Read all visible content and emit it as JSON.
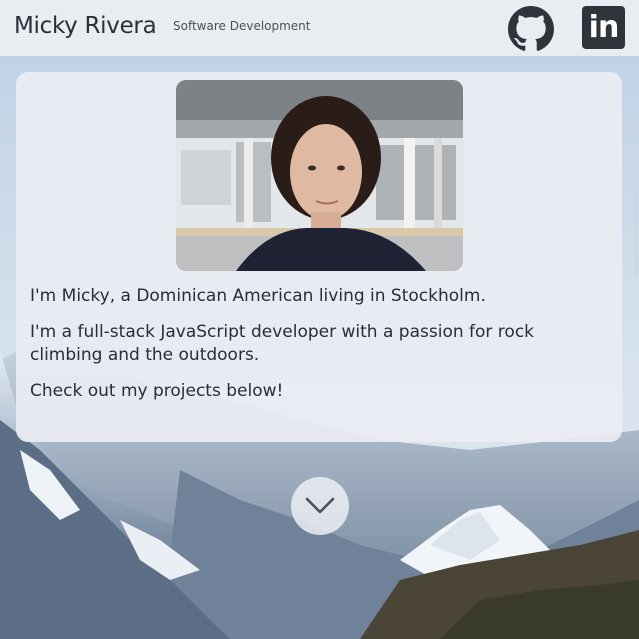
{
  "header": {
    "name": "Micky Rivera",
    "subtitle": "Software Development",
    "github_icon": "github-icon",
    "linkedin_icon": "linkedin-icon",
    "linkedin_label": "in"
  },
  "profile": {
    "photo": "profile-photo",
    "bio": [
      "I'm Micky, a Dominican American living in Stockholm.",
      "I'm a full-stack JavaScript developer with a passion for rock climbing and the outdoors.",
      "Check out my projects below!"
    ]
  },
  "scroll_button": {
    "icon": "chevron-down-icon"
  },
  "colors": {
    "header_bg": "#e9edf2",
    "text": "#2b2f36",
    "sky": "#c9d8e8"
  }
}
